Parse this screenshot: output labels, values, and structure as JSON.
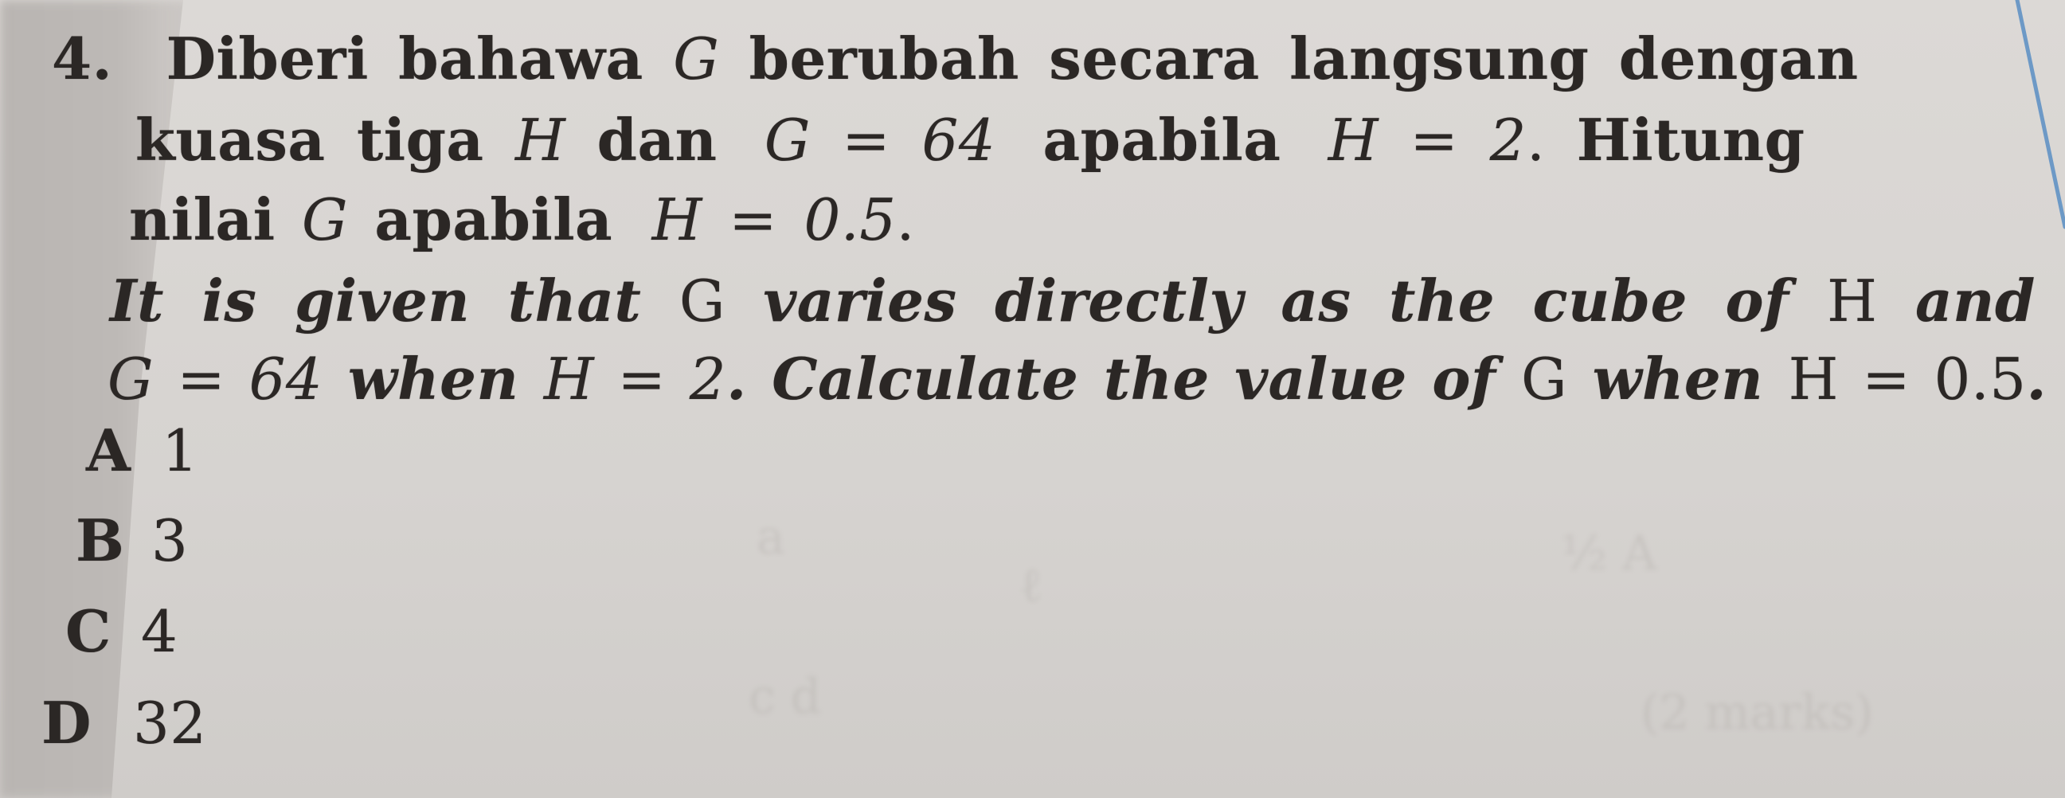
{
  "question": {
    "number": "4.",
    "malay": {
      "line1": {
        "w1": "Diberi",
        "w2": "bahawa",
        "var_g": "G",
        "w3": "berubah",
        "w4": "secara",
        "w5": "langsung",
        "w6": "dengan"
      },
      "line2": {
        "w1": "kuasa",
        "w2": "tiga",
        "var_h": "H",
        "w3": "dan",
        "eq1": "G = 64",
        "w4": "apabila",
        "eq2": "H = 2",
        "punct": ".",
        "w5": "Hitung"
      },
      "line3": {
        "w1": "nilai",
        "var_g": "G",
        "w2": "apabila",
        "eq": "H = 0.5",
        "punct": "."
      }
    },
    "english": {
      "line1": {
        "text_a": "It is given that",
        "var_g": "G",
        "text_b": "varies directly as the cube of",
        "var_h": "H",
        "text_c": "and"
      },
      "line2": {
        "eq1": "G = 64",
        "text_a": "when",
        "eq2": "H = 2",
        "text_b": ". Calculate the value of",
        "var_g": "G",
        "text_c": "when",
        "eq3": "H = 0.5",
        "punct": "."
      }
    },
    "options": [
      {
        "letter": "A",
        "value": "1"
      },
      {
        "letter": "B",
        "value": "3"
      },
      {
        "letter": "C",
        "value": "4"
      },
      {
        "letter": "D",
        "value": "32"
      }
    ]
  },
  "colors": {
    "paper": "#d9d6d3",
    "ink": "#2b2725",
    "margin_line": "#5a8fc4"
  }
}
